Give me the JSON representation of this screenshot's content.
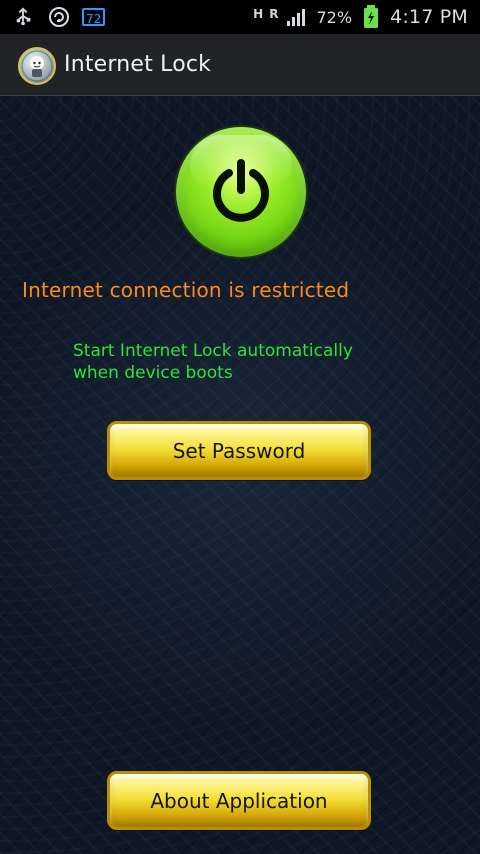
{
  "status_bar": {
    "battery_box_text": "72",
    "network_h": "H",
    "network_r": "R",
    "battery_percent": "72%",
    "time": "4:17 PM",
    "icons": [
      "usb-icon",
      "sync-icon",
      "battery-box-icon",
      "signal-icon",
      "battery-icon"
    ]
  },
  "app_bar": {
    "title": "Internet Lock",
    "icon": "app-icon"
  },
  "main": {
    "power_icon": "power-icon",
    "restriction_text": "Internet connection is restricted",
    "autostart_line1": "Start Internet Lock automatically",
    "autostart_line2": "when device boots",
    "set_password_label": "Set Password",
    "about_label": "About Application"
  },
  "colors": {
    "accent_orange": "#ff8a1c",
    "accent_green": "#32e139",
    "button_gold": "#f3de35",
    "background": "#0e1726"
  }
}
